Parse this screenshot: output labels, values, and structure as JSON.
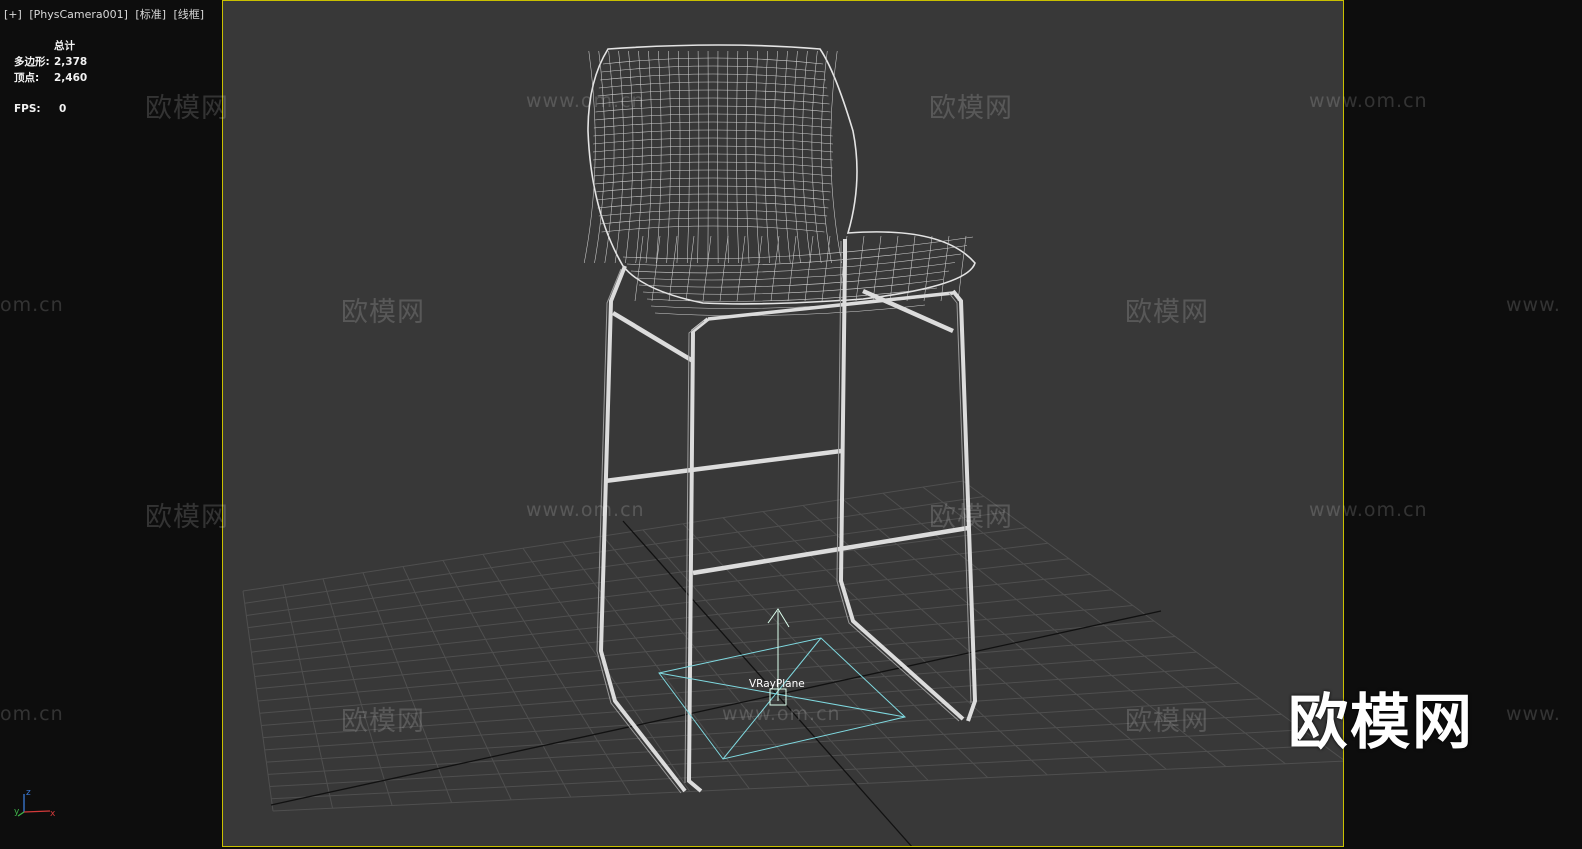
{
  "viewport": {
    "label_parts": [
      "[+]",
      "[PhysCamera001]",
      "[标准]",
      "[线框]"
    ],
    "stats": {
      "header": "总计",
      "rows": [
        {
          "label": "多边形:",
          "value": "2,378"
        },
        {
          "label": "顶点:",
          "value": "2,460"
        }
      ],
      "fps_label": "FPS:",
      "fps_value": "0"
    },
    "object_label": "VRayPlane",
    "axis_labels": {
      "z": "z",
      "x": "x",
      "y": "y"
    }
  },
  "watermarks": {
    "brand": "欧模网",
    "url": "www.om.cn",
    "url_partial_left": "om.cn",
    "url_partial_right": "www.",
    "big_logo": "欧模网"
  },
  "colors": {
    "viewport_bg": "#383838",
    "border_active": "#c9c000",
    "wire": "#e6e6e6",
    "grid": "#4d4d4d",
    "gizmo": "#7fd9e0"
  }
}
